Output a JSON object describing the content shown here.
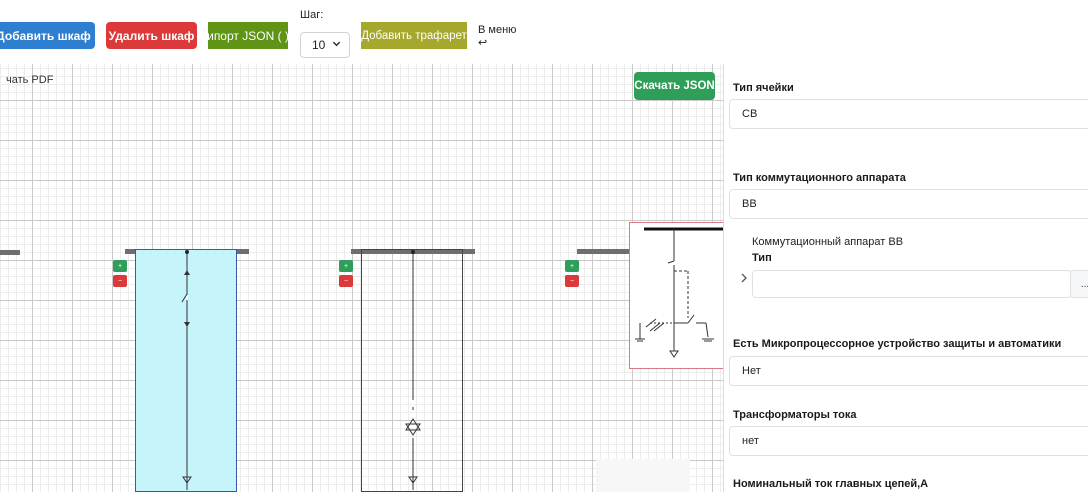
{
  "toolbar": {
    "add_cabinet": "Добавить шкаф",
    "delete_cabinet": "Удалить шкаф",
    "import_json": "ипорт JSON ( )",
    "step_label": "Шаг:",
    "step_value": "10",
    "add_stencil": "Добавить трафарет",
    "menu_link": "В меню",
    "menu_return_glyph": "↩"
  },
  "canvas": {
    "download_pdf": "чать PDF",
    "download_json": "Скачать JSON"
  },
  "icons": {
    "step_chevron": "chevron-down-icon",
    "sub_chevron": "chevron-right-icon"
  },
  "panel": {
    "cell_type_label": "Тип ячейки",
    "cell_type_value": "СВ",
    "switch_type_label": "Тип коммутационного аппарата",
    "switch_type_value": "ВВ",
    "switch_section_title": "Коммутационный аппарат ВВ",
    "switch_section_type_label": "Тип",
    "switch_section_type_value": "",
    "switch_section_more": "...",
    "mpu_label": "Есть Микропроцессорное устройство защиты и автоматики",
    "mpu_value": "Нет",
    "ct_label": "Трансформаторы тока",
    "ct_value": "нет",
    "rated_current_label": "Номинальный ток главных цепей,А"
  },
  "colors": {
    "primary": "#2f7fd0",
    "danger": "#dc3a3a",
    "success": "#2e9e58",
    "import": "#5f9417",
    "stencil": "#a6a72d",
    "selected_cabinet": "#c6f4fb"
  }
}
